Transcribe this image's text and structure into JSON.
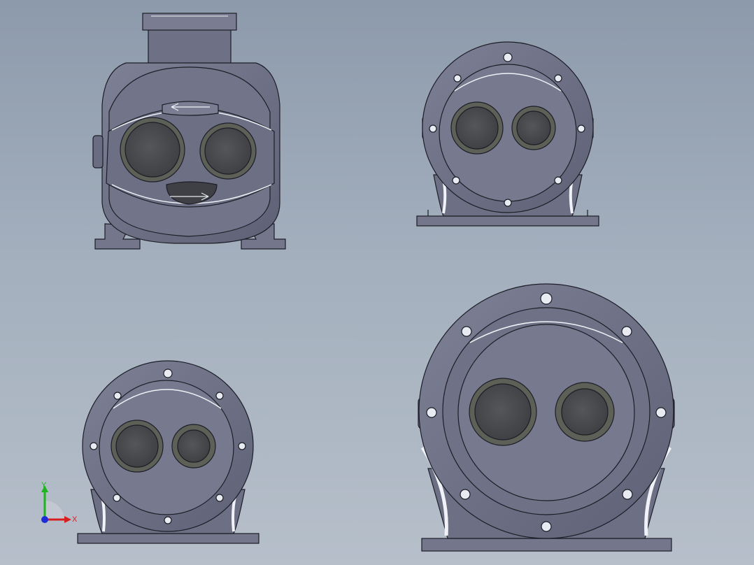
{
  "view": {
    "background_top": "#8d9aab",
    "background_bottom": "#b6bfca",
    "body_color": "#6b6e82",
    "face_color": "#77798d",
    "port_color": "#4b4c4e",
    "port_ring_color": "#5d6056",
    "edge_color": "#1c1d26",
    "highlight_color": "#f2f3f8"
  },
  "triad": {
    "x_label": "X",
    "y_label": "Y",
    "x_color": "#d81f1f",
    "y_color": "#1db41d",
    "z_color": "#1d2cd8"
  }
}
